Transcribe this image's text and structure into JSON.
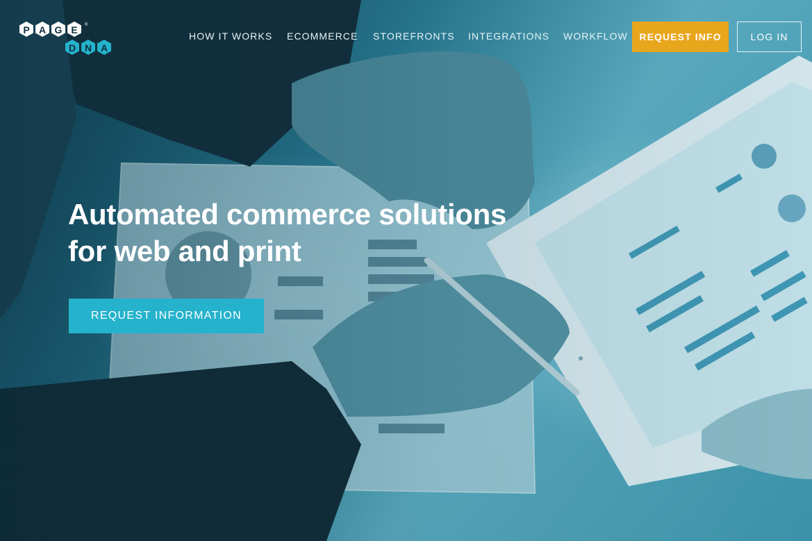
{
  "brand": {
    "logo_top": [
      "P",
      "A",
      "G",
      "E"
    ],
    "logo_bottom": [
      "D",
      "N",
      "A"
    ],
    "accent_color": "#25b2cc",
    "logo_hex_color": "#ffffff"
  },
  "nav": {
    "items": [
      {
        "label": "HOW IT WORKS"
      },
      {
        "label": "ECOMMERCE"
      },
      {
        "label": "STOREFRONTS"
      },
      {
        "label": "INTEGRATIONS"
      },
      {
        "label": "WORKFLOW"
      }
    ],
    "request_info_label": "REQUEST INFO",
    "request_info_color": "#e8a61c",
    "login_label": "LOG IN"
  },
  "hero": {
    "headline_line1": "Automated commerce solutions",
    "headline_line2": "for web and print",
    "cta_label": "REQUEST INFORMATION",
    "cta_color": "#25b2cc"
  }
}
